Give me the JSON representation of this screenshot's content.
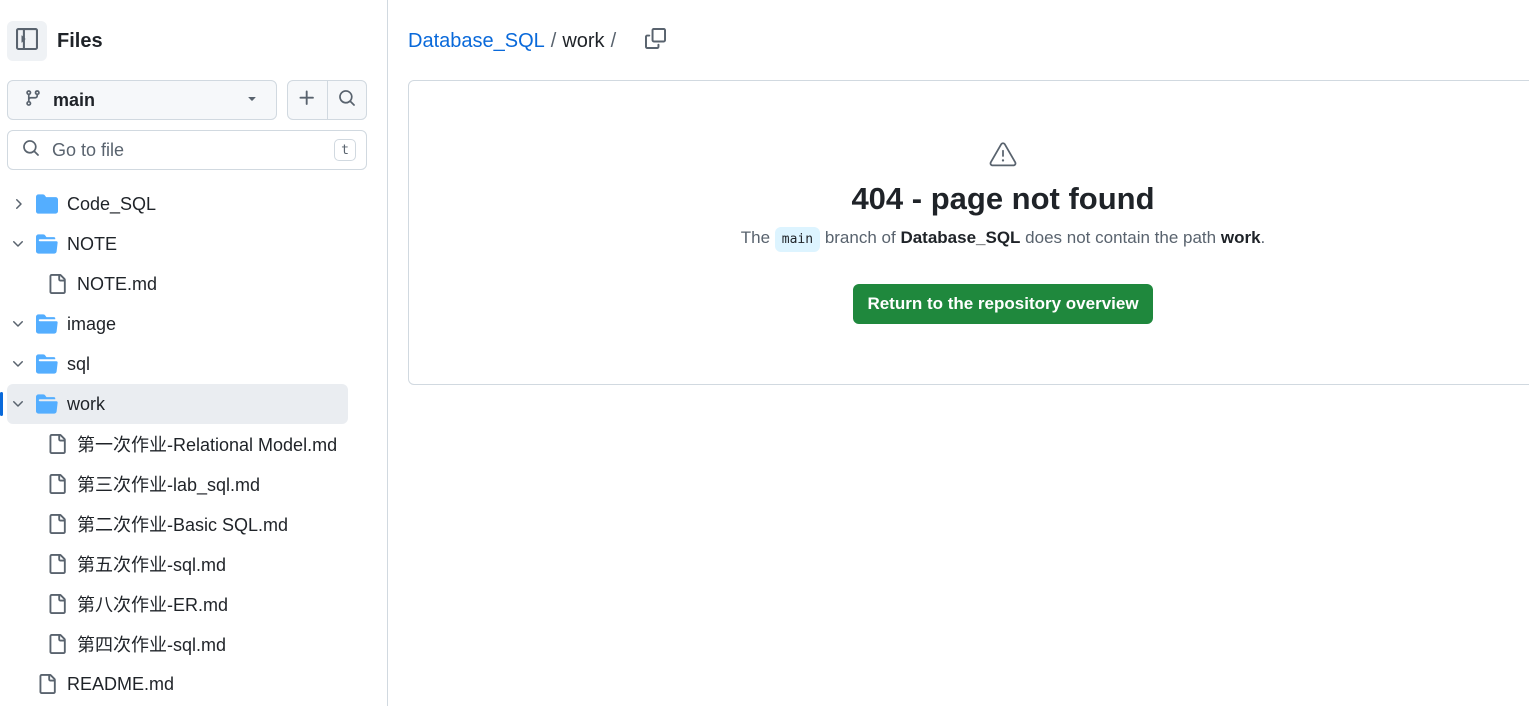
{
  "sidebar": {
    "title": "Files",
    "branch": "main",
    "goto_placeholder": "Go to file",
    "goto_shortcut": "t",
    "tree": [
      {
        "label": "Code_SQL",
        "type": "folder",
        "expanded": false
      },
      {
        "label": "NOTE",
        "type": "folder",
        "expanded": true
      },
      {
        "label": "NOTE.md",
        "type": "file"
      },
      {
        "label": "image",
        "type": "folder",
        "expanded": true
      },
      {
        "label": "sql",
        "type": "folder",
        "expanded": true
      },
      {
        "label": "work",
        "type": "folder",
        "expanded": true,
        "selected": true
      },
      {
        "label": "第一次作业-Relational Model.md",
        "type": "file"
      },
      {
        "label": "第三次作业-lab_sql.md",
        "type": "file"
      },
      {
        "label": "第二次作业-Basic SQL.md",
        "type": "file"
      },
      {
        "label": "第五次作业-sql.md",
        "type": "file"
      },
      {
        "label": "第八次作业-ER.md",
        "type": "file"
      },
      {
        "label": "第四次作业-sql.md",
        "type": "file"
      },
      {
        "label": "README.md",
        "type": "file"
      }
    ]
  },
  "breadcrumb": {
    "repo": "Database_SQL",
    "sep1": "/",
    "current": "work",
    "sep2": "/"
  },
  "error": {
    "title": "404 - page not found",
    "msg_the": "The",
    "branch_code": "main",
    "msg_branch_of": "branch of",
    "repo": "Database_SQL",
    "msg_not_contain": "does not contain the path",
    "path": "work",
    "period": ".",
    "button": "Return to the repository overview"
  },
  "colors": {
    "link": "#0969da",
    "folder": "#54aeff",
    "primary_button": "#1f883d",
    "selection_bar": "#0969da"
  }
}
